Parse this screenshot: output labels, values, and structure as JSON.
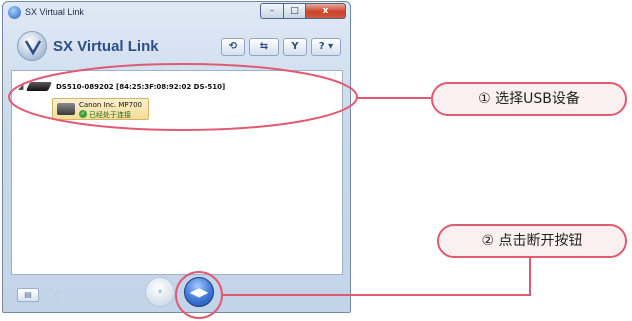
{
  "window": {
    "title": "SX Virtual Link",
    "controls": {
      "minimize": "–",
      "maximize": "□",
      "close": "x"
    }
  },
  "app": {
    "title": "SX Virtual Link",
    "toolbar": [
      "⟲",
      "⇆",
      "Y",
      "? ▾"
    ]
  },
  "tree": {
    "expander": "◢",
    "server_label": "DS510-089202 [84:25:3F:08:92:02 DS-510]",
    "device": {
      "name": "Canon Inc. MP700",
      "status": "已经处于连接"
    }
  },
  "bottom_bar": {
    "connect_symbol": "•",
    "disconnect_symbol": "◀▶"
  },
  "annotations": [
    {
      "label": "① 选择USB设备"
    },
    {
      "label": "② 点击断开按钮"
    }
  ],
  "colors": {
    "annotation": "#e05a72",
    "callout_fill": "#fbf0f1"
  }
}
